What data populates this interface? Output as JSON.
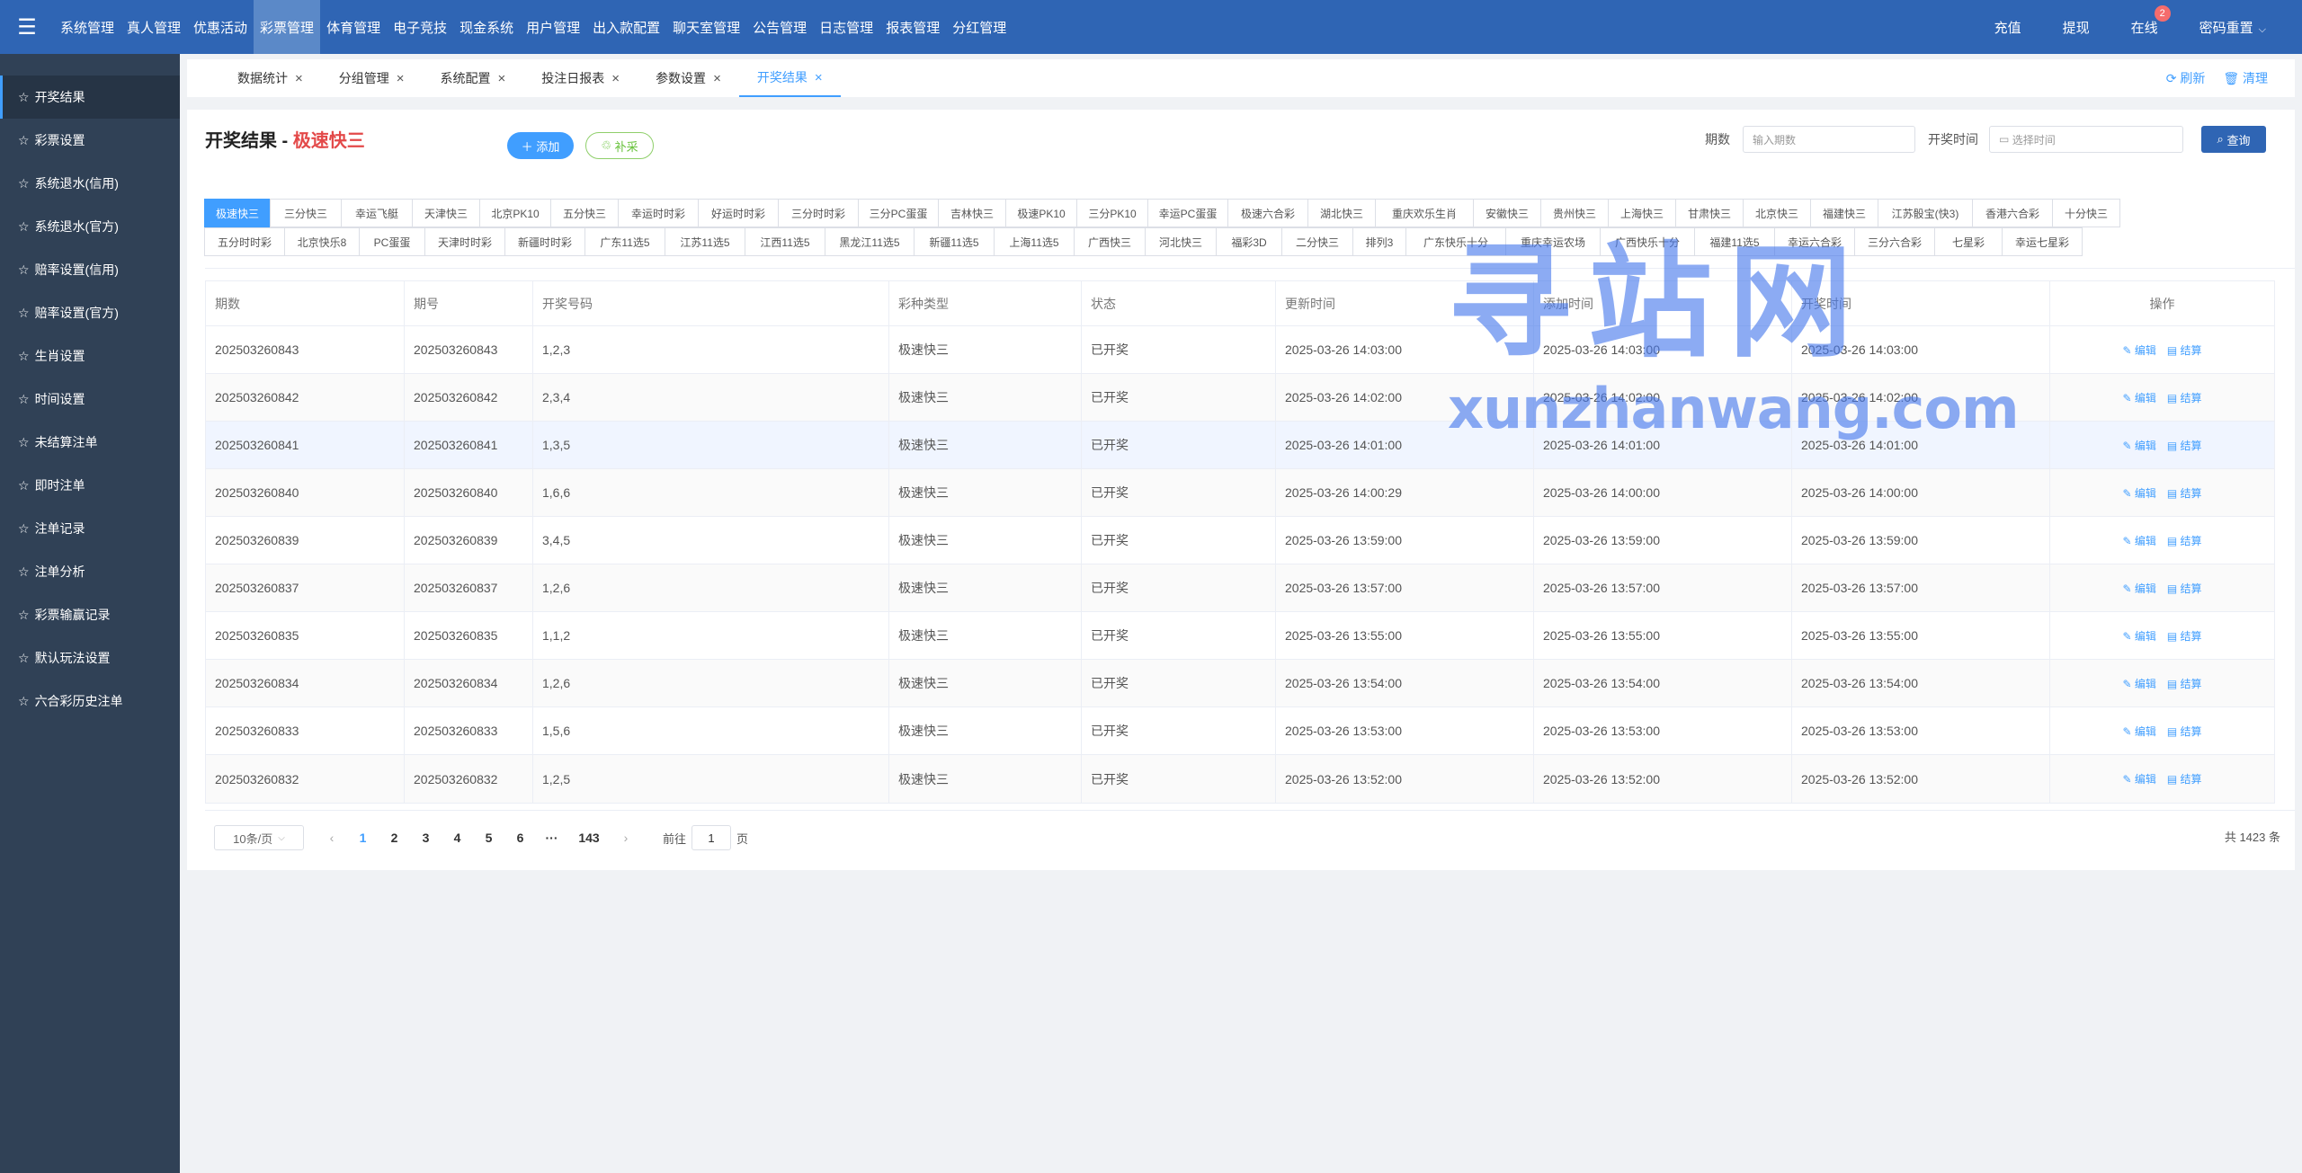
{
  "topbar": {
    "nav": [
      "系统管理",
      "真人管理",
      "优惠活动",
      "彩票管理",
      "体育管理",
      "电子竞技",
      "现金系统",
      "用户管理",
      "出入款配置",
      "聊天室管理",
      "公告管理",
      "日志管理",
      "报表管理",
      "分红管理"
    ],
    "active_nav": 3,
    "right": {
      "recharge": "充值",
      "withdraw": "提现",
      "online": "在线",
      "online_count": "2",
      "password_reset": "密码重置"
    }
  },
  "sidebar": {
    "items": [
      "开奖结果",
      "彩票设置",
      "系统退水(信用)",
      "系统退水(官方)",
      "赔率设置(信用)",
      "赔率设置(官方)",
      "生肖设置",
      "时间设置",
      "未结算注单",
      "即时注单",
      "注单记录",
      "注单分析",
      "彩票输赢记录",
      "默认玩法设置",
      "六合彩历史注单"
    ],
    "active": 0
  },
  "tabs": {
    "items": [
      "数据统计",
      "分组管理",
      "系统配置",
      "投注日报表",
      "参数设置",
      "开奖结果"
    ],
    "active": 5,
    "refresh": "刷新",
    "clear": "清理"
  },
  "page": {
    "title": "开奖结果",
    "separator": " - ",
    "subtitle": "极速快三",
    "add_label": "添加",
    "cai_label": "补采",
    "filter_period_label": "期数",
    "filter_period_placeholder": "输入期数",
    "filter_time_label": "开奖时间",
    "filter_time_placeholder": "选择时间",
    "query_label": "查询"
  },
  "lottery_types": {
    "row1": [
      "极速快三",
      "三分快三",
      "幸运飞艇",
      "天津快三",
      "北京PK10",
      "五分快三",
      "幸运时时彩",
      "好运时时彩",
      "三分时时彩",
      "三分PC蛋蛋",
      "吉林快三",
      "极速PK10",
      "三分PK10",
      "幸运PC蛋蛋",
      "极速六合彩",
      "湖北快三",
      "重庆欢乐生肖",
      "安徽快三",
      "贵州快三",
      "上海快三",
      "甘肃快三",
      "北京快三",
      "福建快三",
      "江苏骰宝(快3)",
      "香港六合彩",
      "十分快三"
    ],
    "row2": [
      "五分时时彩",
      "北京快乐8",
      "PC蛋蛋",
      "天津时时彩",
      "新疆时时彩",
      "广东11选5",
      "江苏11选5",
      "江西11选5",
      "黑龙江11选5",
      "新疆11选5",
      "上海11选5",
      "广西快三",
      "河北快三",
      "福彩3D",
      "二分快三",
      "排列3",
      "广东快乐十分",
      "重庆幸运农场",
      "广西快乐十分",
      "福建11选5",
      "幸运六合彩",
      "三分六合彩",
      "七星彩",
      "幸运七星彩"
    ],
    "active": 0
  },
  "table": {
    "headers": [
      "期数",
      "期号",
      "开奖号码",
      "彩种类型",
      "状态",
      "更新时间",
      "添加时间",
      "开奖时间",
      "操作"
    ],
    "edit_label": "编辑",
    "settle_label": "结算",
    "rows": [
      [
        "202503260843",
        "202503260843",
        "1,2,3",
        "极速快三",
        "已开奖",
        "2025-03-26 14:03:00",
        "2025-03-26 14:03:00",
        "2025-03-26 14:03:00"
      ],
      [
        "202503260842",
        "202503260842",
        "2,3,4",
        "极速快三",
        "已开奖",
        "2025-03-26 14:02:00",
        "2025-03-26 14:02:00",
        "2025-03-26 14:02:00"
      ],
      [
        "202503260841",
        "202503260841",
        "1,3,5",
        "极速快三",
        "已开奖",
        "2025-03-26 14:01:00",
        "2025-03-26 14:01:00",
        "2025-03-26 14:01:00"
      ],
      [
        "202503260840",
        "202503260840",
        "1,6,6",
        "极速快三",
        "已开奖",
        "2025-03-26 14:00:29",
        "2025-03-26 14:00:00",
        "2025-03-26 14:00:00"
      ],
      [
        "202503260839",
        "202503260839",
        "3,4,5",
        "极速快三",
        "已开奖",
        "2025-03-26 13:59:00",
        "2025-03-26 13:59:00",
        "2025-03-26 13:59:00"
      ],
      [
        "202503260837",
        "202503260837",
        "1,2,6",
        "极速快三",
        "已开奖",
        "2025-03-26 13:57:00",
        "2025-03-26 13:57:00",
        "2025-03-26 13:57:00"
      ],
      [
        "202503260835",
        "202503260835",
        "1,1,2",
        "极速快三",
        "已开奖",
        "2025-03-26 13:55:00",
        "2025-03-26 13:55:00",
        "2025-03-26 13:55:00"
      ],
      [
        "202503260834",
        "202503260834",
        "1,2,6",
        "极速快三",
        "已开奖",
        "2025-03-26 13:54:00",
        "2025-03-26 13:54:00",
        "2025-03-26 13:54:00"
      ],
      [
        "202503260833",
        "202503260833",
        "1,5,6",
        "极速快三",
        "已开奖",
        "2025-03-26 13:53:00",
        "2025-03-26 13:53:00",
        "2025-03-26 13:53:00"
      ],
      [
        "202503260832",
        "202503260832",
        "1,2,5",
        "极速快三",
        "已开奖",
        "2025-03-26 13:52:00",
        "2025-03-26 13:52:00",
        "2025-03-26 13:52:00"
      ]
    ]
  },
  "pagination": {
    "page_size": "10条/页",
    "pages": [
      "1",
      "2",
      "3",
      "4",
      "5",
      "6"
    ],
    "ellipsis": "···",
    "last_page": "143",
    "current": 0,
    "goto_prefix": "前往",
    "goto_value": "1",
    "goto_suffix": "页",
    "total": "共 1423 条"
  },
  "watermark": {
    "cn": "寻站网",
    "en": "xunzhanwang.com"
  },
  "colors": {
    "topbar": "#2f65b4",
    "sidebar": "#304156",
    "accent": "#409eff",
    "title_red": "#e34949"
  }
}
